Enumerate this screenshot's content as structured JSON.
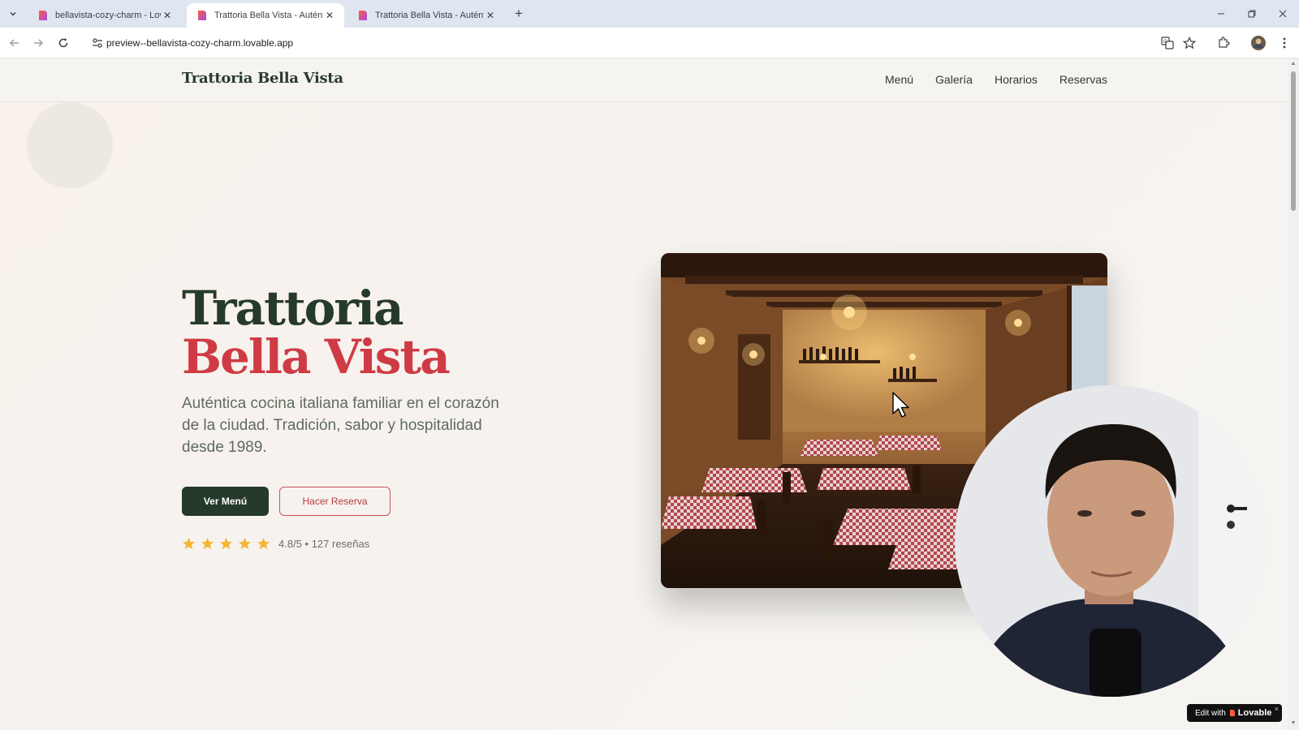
{
  "browser": {
    "tabs": [
      {
        "title": "bellavista-cozy-charm - Lovable",
        "active": false
      },
      {
        "title": "Trattoria Bella Vista - Auténtica",
        "active": true
      },
      {
        "title": "Trattoria Bella Vista - Auténtica",
        "active": false
      }
    ],
    "url": "preview--bellavista-cozy-charm.lovable.app"
  },
  "site": {
    "brand": "Trattoria Bella Vista",
    "nav": [
      "Menú",
      "Galería",
      "Horarios",
      "Reservas"
    ],
    "hero": {
      "title_line1": "Trattoria",
      "title_line2": "Bella Vista",
      "subtitle": "Auténtica cocina italiana familiar en el corazón de la ciudad. Tradición, sabor y hospitalidad desde 1989.",
      "primary_button": "Ver Menú",
      "secondary_button": "Hacer Reserva",
      "stars": 5,
      "rating_text": "4.8/5 • 127 reseñas"
    }
  },
  "badge": {
    "prefix": "Edit with",
    "brand": "Lovable",
    "close": "×"
  },
  "colors": {
    "primary_green": "#263a2a",
    "accent_red": "#cf3b45",
    "star_gold": "#f2b632"
  }
}
